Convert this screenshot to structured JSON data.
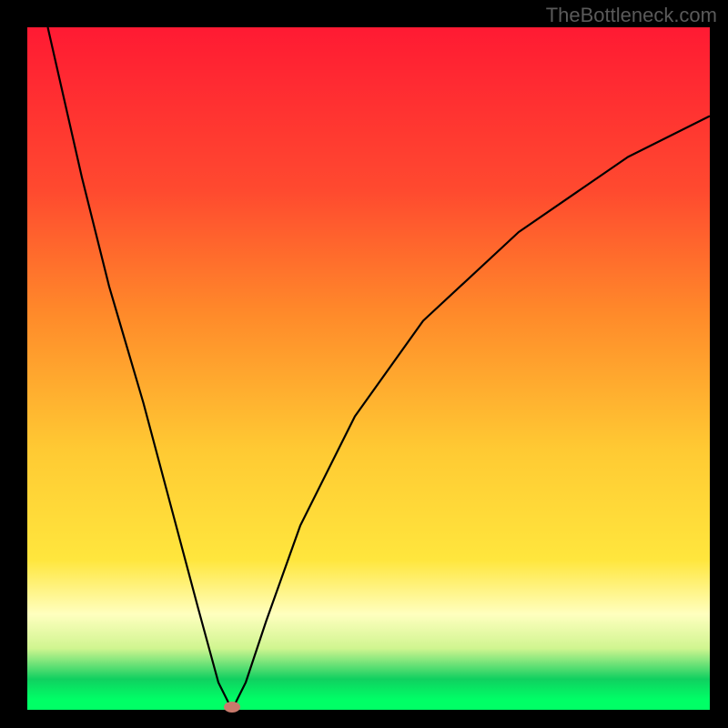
{
  "watermark": "TheBottleneck.com",
  "chart_data": {
    "type": "line",
    "title": "",
    "xlabel": "",
    "ylabel": "",
    "xlim": [
      0,
      100
    ],
    "ylim": [
      0,
      100
    ],
    "minimum_point": {
      "x": 30,
      "y": 0
    },
    "series": [
      {
        "name": "bottleneck-curve",
        "description": "V-shaped curve descending steeply from top-left to a minimum near x≈30, then rising toward upper right",
        "x": [
          3,
          8,
          12,
          17,
          21,
          25,
          28,
          30,
          32,
          35,
          40,
          48,
          58,
          72,
          88,
          100
        ],
        "values": [
          100,
          78,
          62,
          45,
          30,
          15,
          4,
          0,
          4,
          13,
          27,
          43,
          57,
          70,
          81,
          87
        ]
      }
    ],
    "gradient_colors": {
      "top": "#ff1a33",
      "orange": "#ff8a2a",
      "yellow": "#ffe63d",
      "pale_yellow": "#ffffbf",
      "green": "#10d060",
      "bright_green": "#00ff66"
    },
    "marker": {
      "x": 30,
      "y": 0,
      "color": "#c97a6c"
    }
  }
}
